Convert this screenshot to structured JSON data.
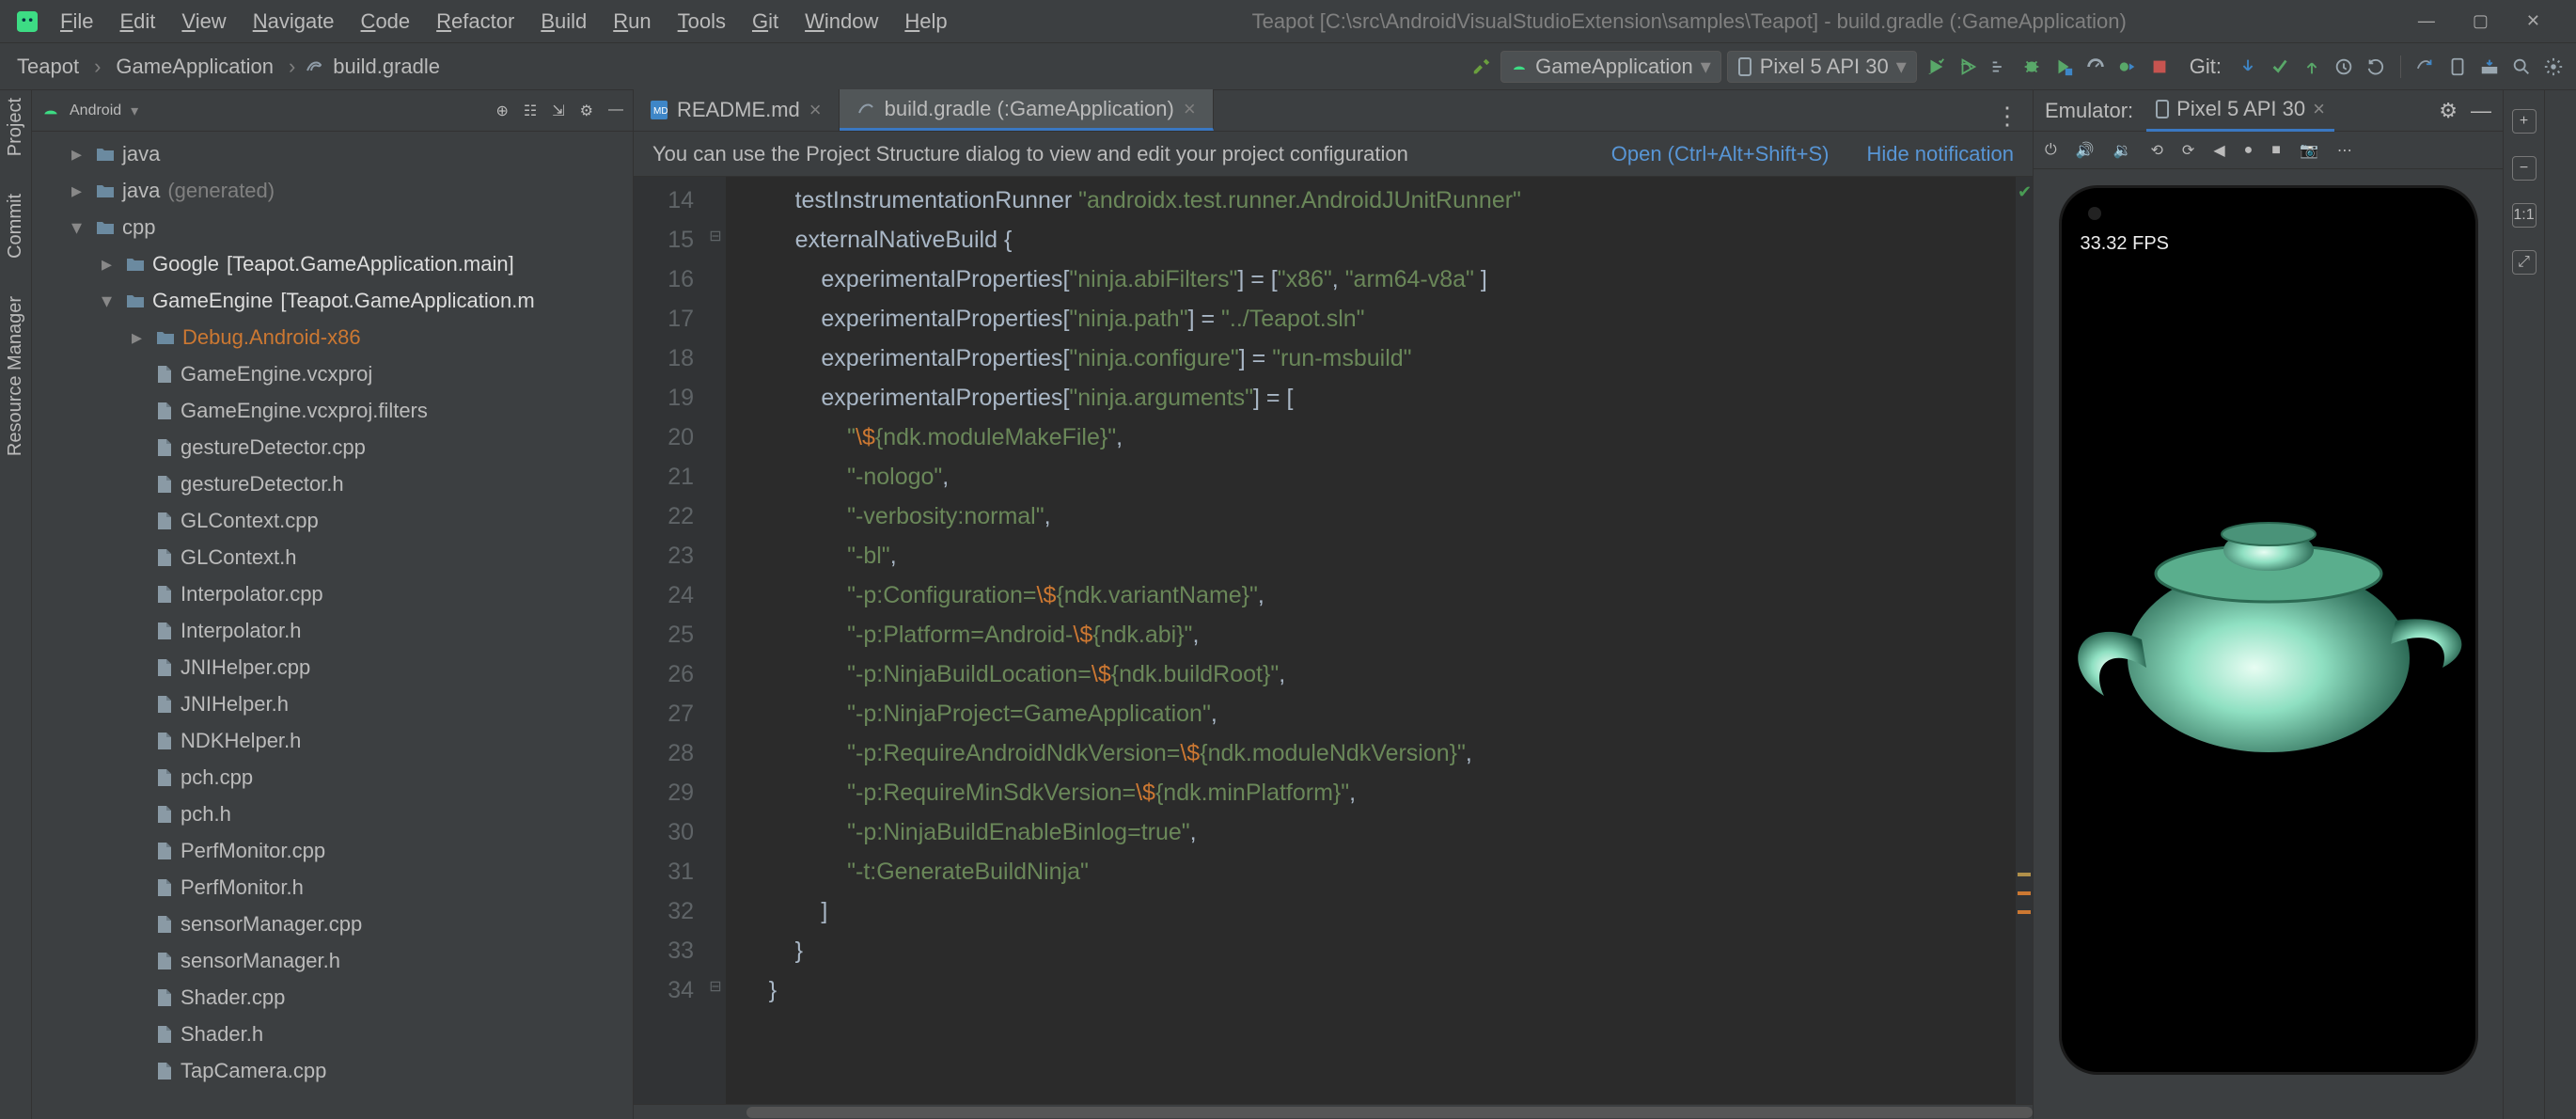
{
  "menubar": {
    "items": [
      "File",
      "Edit",
      "View",
      "Navigate",
      "Code",
      "Refactor",
      "Build",
      "Run",
      "Tools",
      "Git",
      "Window",
      "Help"
    ],
    "title": "Teapot [C:\\src\\AndroidVisualStudioExtension\\samples\\Teapot] - build.gradle (:GameApplication)"
  },
  "breadcrumb": {
    "root": "Teapot",
    "mid": "GameApplication",
    "file": "build.gradle"
  },
  "run": {
    "config": "GameApplication",
    "device": "Pixel 5 API 30",
    "git_label": "Git:"
  },
  "project": {
    "header": "Android",
    "nodes": [
      {
        "depth": 1,
        "chev": ">",
        "type": "folder",
        "label": "java"
      },
      {
        "depth": 1,
        "chev": ">",
        "type": "folder",
        "label": "java",
        "suffix": " (generated)"
      },
      {
        "depth": 1,
        "chev": "v",
        "type": "folder",
        "label": "cpp"
      },
      {
        "depth": 2,
        "chev": ">",
        "type": "folder",
        "label": "Google",
        "suffix": " [Teapot.GameApplication.main]",
        "bold": true
      },
      {
        "depth": 2,
        "chev": "v",
        "type": "folder",
        "label": "GameEngine",
        "suffix": " [Teapot.GameApplication.m",
        "bold": true
      },
      {
        "depth": 3,
        "chev": ">",
        "type": "folder",
        "label": "Debug.Android-x86",
        "hl": true
      },
      {
        "depth": 3,
        "type": "file",
        "label": "GameEngine.vcxproj"
      },
      {
        "depth": 3,
        "type": "file",
        "label": "GameEngine.vcxproj.filters"
      },
      {
        "depth": 3,
        "type": "file",
        "label": "gestureDetector.cpp"
      },
      {
        "depth": 3,
        "type": "file",
        "label": "gestureDetector.h"
      },
      {
        "depth": 3,
        "type": "file",
        "label": "GLContext.cpp"
      },
      {
        "depth": 3,
        "type": "file",
        "label": "GLContext.h"
      },
      {
        "depth": 3,
        "type": "file",
        "label": "Interpolator.cpp"
      },
      {
        "depth": 3,
        "type": "file",
        "label": "Interpolator.h"
      },
      {
        "depth": 3,
        "type": "file",
        "label": "JNIHelper.cpp"
      },
      {
        "depth": 3,
        "type": "file",
        "label": "JNIHelper.h"
      },
      {
        "depth": 3,
        "type": "file",
        "label": "NDKHelper.h"
      },
      {
        "depth": 3,
        "type": "file",
        "label": "pch.cpp"
      },
      {
        "depth": 3,
        "type": "file",
        "label": "pch.h"
      },
      {
        "depth": 3,
        "type": "file",
        "label": "PerfMonitor.cpp"
      },
      {
        "depth": 3,
        "type": "file",
        "label": "PerfMonitor.h"
      },
      {
        "depth": 3,
        "type": "file",
        "label": "sensorManager.cpp"
      },
      {
        "depth": 3,
        "type": "file",
        "label": "sensorManager.h"
      },
      {
        "depth": 3,
        "type": "file",
        "label": "Shader.cpp"
      },
      {
        "depth": 3,
        "type": "file",
        "label": "Shader.h"
      },
      {
        "depth": 3,
        "type": "file",
        "label": "TapCamera.cpp"
      }
    ]
  },
  "left_toolwindows": [
    "Project",
    "Commit",
    "Resource Manager"
  ],
  "editor": {
    "tabs": [
      {
        "label": "README.md",
        "active": false
      },
      {
        "label": "build.gradle (:GameApplication)",
        "active": true
      }
    ],
    "notification": "You can use the Project Structure dialog to view and edit your project configuration",
    "notif_link_open": "Open (Ctrl+Alt+Shift+S)",
    "notif_link_hide": "Hide notification",
    "first_line_no": 14,
    "lines": [
      {
        "html": "        <span class='tok-id'>testInstrumentationRunner</span> <span class='tok-str'>\"androidx.test.runner.AndroidJUnitRunner\"</span>"
      },
      {
        "html": "        <span class='tok-id'>externalNativeBuild</span> <span class='tok-punc'>{</span>"
      },
      {
        "html": "            <span class='tok-id'>experimentalProperties</span><span class='tok-punc'>[</span><span class='tok-str'>\"ninja.abiFilters\"</span><span class='tok-punc'>] = [</span><span class='tok-str'>\"x86\"</span><span class='tok-punc'>, </span><span class='tok-str'>\"arm64-v8a\"</span><span class='tok-punc'> ]</span>"
      },
      {
        "html": "            <span class='tok-id'>experimentalProperties</span><span class='tok-punc'>[</span><span class='tok-str'>\"ninja.path\"</span><span class='tok-punc'>] = </span><span class='tok-str'>\"../Teapot.sln\"</span>"
      },
      {
        "html": "            <span class='tok-id'>experimentalProperties</span><span class='tok-punc'>[</span><span class='tok-str'>\"ninja.configure\"</span><span class='tok-punc'>] = </span><span class='tok-str'>\"run-msbuild\"</span>"
      },
      {
        "html": "            <span class='tok-id'>experimentalProperties</span><span class='tok-punc'>[</span><span class='tok-str'>\"ninja.arguments\"</span><span class='tok-punc'>] = [</span>"
      },
      {
        "html": "                <span class='tok-str'>\"<span class='tok-esc'>\\$</span>{ndk.moduleMakeFile}\"</span><span class='tok-punc'>,</span>"
      },
      {
        "html": "                <span class='tok-str'>\"-nologo\"</span><span class='tok-punc'>,</span>"
      },
      {
        "html": "                <span class='tok-str'>\"-verbosity:normal\"</span><span class='tok-punc'>,</span>"
      },
      {
        "html": "                <span class='tok-str'>\"-bl\"</span><span class='tok-punc'>,</span>"
      },
      {
        "html": "                <span class='tok-str'>\"-p:Configuration=<span class='tok-esc'>\\$</span>{ndk.variantName}\"</span><span class='tok-punc'>,</span>"
      },
      {
        "html": "                <span class='tok-str'>\"-p:Platform=Android-<span class='tok-esc'>\\$</span>{ndk.abi}\"</span><span class='tok-punc'>,</span>"
      },
      {
        "html": "                <span class='tok-str'>\"-p:NinjaBuildLocation=<span class='tok-esc'>\\$</span>{ndk.buildRoot}\"</span><span class='tok-punc'>,</span>"
      },
      {
        "html": "                <span class='tok-str'>\"-p:NinjaProject=GameApplication\"</span><span class='tok-punc'>,</span>"
      },
      {
        "html": "                <span class='tok-str'>\"-p:RequireAndroidNdkVersion=<span class='tok-esc'>\\$</span>{ndk.moduleNdkVersion}\"</span><span class='tok-punc'>,</span>"
      },
      {
        "html": "                <span class='tok-str'>\"-p:RequireMinSdkVersion=<span class='tok-esc'>\\$</span>{ndk.minPlatform}\"</span><span class='tok-punc'>,</span>"
      },
      {
        "html": "                <span class='tok-str'>\"-p:NinjaBuildEnableBinlog=true\"</span><span class='tok-punc'>,</span>"
      },
      {
        "html": "                <span class='tok-str'>\"-t:GenerateBuildNinja\"</span>"
      },
      {
        "html": "            <span class='tok-punc'>]</span>"
      },
      {
        "html": "        <span class='tok-punc'>}</span>"
      },
      {
        "html": "    <span class='tok-punc'>}</span>"
      }
    ]
  },
  "emulator": {
    "label": "Emulator:",
    "device": "Pixel 5 API 30",
    "fps": "33.32 FPS",
    "side_buttons": [
      "+",
      "−",
      "1:1",
      "⤢"
    ]
  }
}
